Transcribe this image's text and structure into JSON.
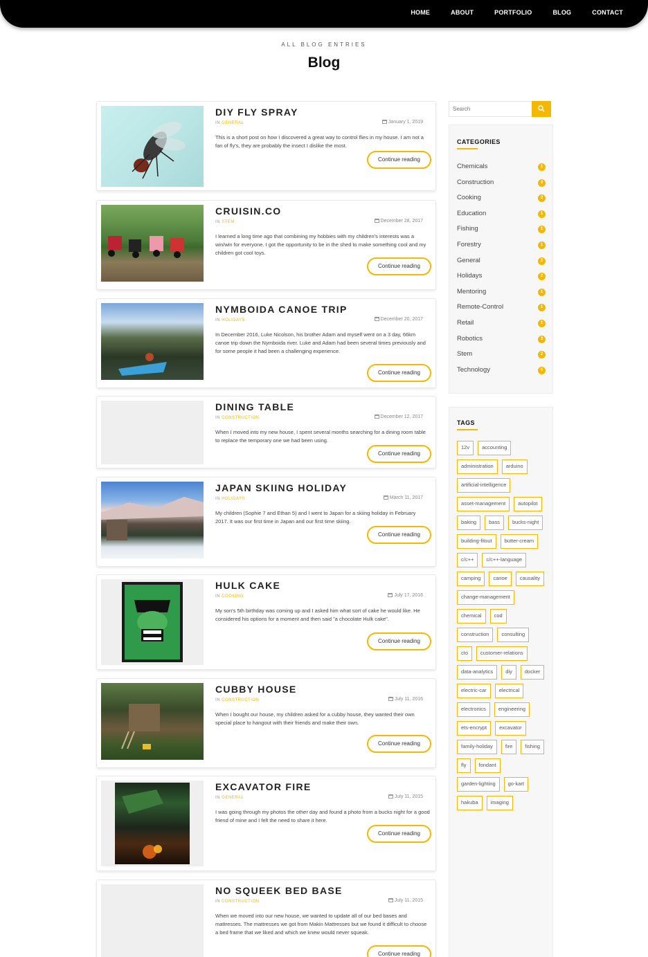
{
  "nav": {
    "items": [
      "HOME",
      "ABOUT",
      "PORTFOLIO",
      "BLOG",
      "CONTACT"
    ]
  },
  "header": {
    "kicker": "ALL BLOG ENTRIES",
    "title": "Blog"
  },
  "post_in_prefix": "IN",
  "read_more_label": "Continue reading",
  "posts": [
    {
      "title": "DIY FLY SPRAY",
      "category": "GENERAL",
      "date": "January 1, 2019",
      "excerpt": "This is a short post on how I discovered a great way to control flies in my house. I am not a fan of fly's, they are probably the insect I dislike the most."
    },
    {
      "title": "CRUISIN.CO",
      "category": "STEM",
      "date": "December 28, 2017",
      "excerpt": "I learned a long time ago that combining my hobbies with my children's interests was a win/win for everyone. I got the opportunity to be in the shed to make something cool and my children got cool toys."
    },
    {
      "title": "NYMBOIDA CANOE TRIP",
      "category": "HOLIDAYS",
      "date": "December 20, 2017",
      "excerpt": "In December 2016, Luke Nicolson, his brother Adam and myself went on a 3 day, 66km canoe trip down the Nymboida river. Luke and Adam had been several times previously and for some people it had been a challenging experience."
    },
    {
      "title": "DINING TABLE",
      "category": "CONSTRUCTION",
      "date": "December 12, 2017",
      "excerpt": "When I moved into my new house, I spent several months searching for a dining room table to replace the temporary one we had been using."
    },
    {
      "title": "JAPAN SKIING HOLIDAY",
      "category": "HOLIDAYS",
      "date": "March 11, 2017",
      "excerpt": "My children (Sophie 7 and Ethan 5) and I went to Japan for a skiing holiday in February 2017. It was our first time in Japan and our first time skiing."
    },
    {
      "title": "HULK CAKE",
      "category": "COOKING",
      "date": "July 17, 2016",
      "excerpt": "My son's 5th birthday was coming up and I asked him what sort of cake he would like. He considered his options for a moment and then said \"a chocolate Hulk cake\"."
    },
    {
      "title": "CUBBY HOUSE",
      "category": "CONSTRUCTION",
      "date": "July 11, 2016",
      "excerpt": "When I bought our house, my children asked for a cubby house, they wanted their own special place to hangout with their friends and make their own."
    },
    {
      "title": "EXCAVATOR FIRE",
      "category": "GENERAL",
      "date": "July 11, 2015",
      "excerpt": "I was going through my photos the other day and found a photo from a bucks night for a good friend of mine and I felt the need to share it here."
    },
    {
      "title": "NO SQUEEK BED BASE",
      "category": "CONSTRUCTION",
      "date": "July 11, 2015",
      "excerpt": "When we moved into our new house, we wanted to update all of our bed bases and mattresses. The mattresses we got from Makin Mattresses but we found it difficult to choose a bed frame that we liked and which we knew would never squeak."
    }
  ],
  "search": {
    "placeholder": "Search"
  },
  "categories": {
    "title": "CATEGORIES",
    "items": [
      {
        "name": "Chemicals",
        "count": "1"
      },
      {
        "name": "Construction",
        "count": "3"
      },
      {
        "name": "Cooking",
        "count": "2"
      },
      {
        "name": "Education",
        "count": "1"
      },
      {
        "name": "Fishing",
        "count": "1"
      },
      {
        "name": "Forestry",
        "count": "1"
      },
      {
        "name": "General",
        "count": "2"
      },
      {
        "name": "Holidays",
        "count": "2"
      },
      {
        "name": "Mentoring",
        "count": "1"
      },
      {
        "name": "Remote-Control",
        "count": "1"
      },
      {
        "name": "Retail",
        "count": "1"
      },
      {
        "name": "Robotics",
        "count": "3"
      },
      {
        "name": "Stem",
        "count": "2"
      },
      {
        "name": "Technology",
        "count": "6"
      }
    ]
  },
  "tags": {
    "title": "TAGS",
    "items": [
      "12v",
      "accounting",
      "administration",
      "arduino",
      "artificial-intelligence",
      "asset-management",
      "autopilot",
      "baking",
      "bass",
      "bucks-night",
      "building-fitout",
      "butter-cream",
      "c/c++",
      "c/c++-language",
      "camping",
      "canoe",
      "causality",
      "change-management",
      "chemical",
      "cod",
      "construction",
      "consulting",
      "cto",
      "customer-relations",
      "data-analytics",
      "diy",
      "docker",
      "electric-car",
      "electrical",
      "electronics",
      "engineering",
      "ets-encrypt",
      "excavator",
      "family-holiday",
      "fire",
      "fishing",
      "fly",
      "fondant",
      "garden-lighting",
      "go-kart",
      "hakuba",
      "imaging"
    ]
  },
  "colors": {
    "accent": "#f5b800",
    "nav_bg": "#000000"
  }
}
